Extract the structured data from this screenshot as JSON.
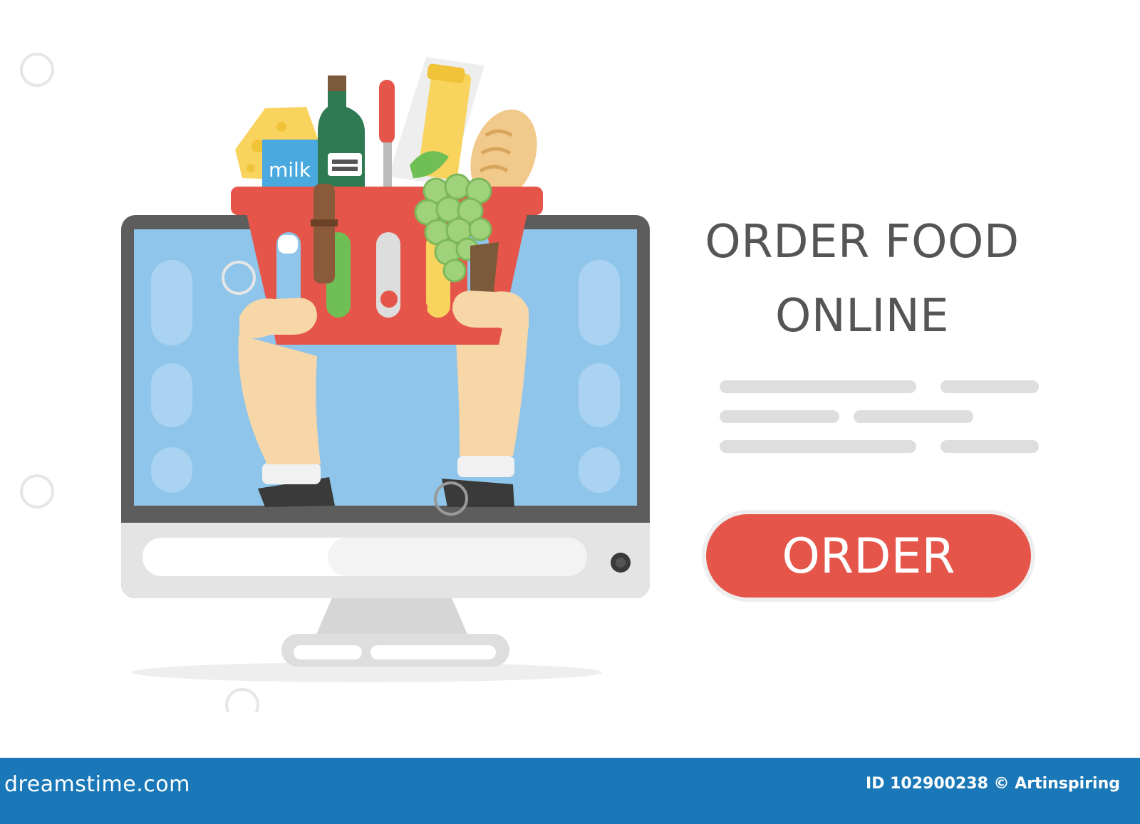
{
  "headline": {
    "line1": "ORDER FOOD",
    "line2": "ONLINE"
  },
  "product_label": "milk",
  "order_button": {
    "label": "ORDER"
  },
  "footer": {
    "brand": "dreamstime.com",
    "credit": "ID 102900238 © Artinspiring"
  },
  "colors": {
    "accent": "#e5554a",
    "screen": "#8fc5ea",
    "monitor_frame": "#5d5d5d",
    "monitor_body": "#dfdfdf",
    "footer": "#1a78b8",
    "text": "#555555"
  },
  "icons": [
    "monitor-icon",
    "shopping-basket-icon",
    "grapes-icon",
    "bread-icon",
    "bottle-icon",
    "cheese-icon",
    "milk-carton-icon",
    "pasta-icon",
    "hand-icon"
  ]
}
